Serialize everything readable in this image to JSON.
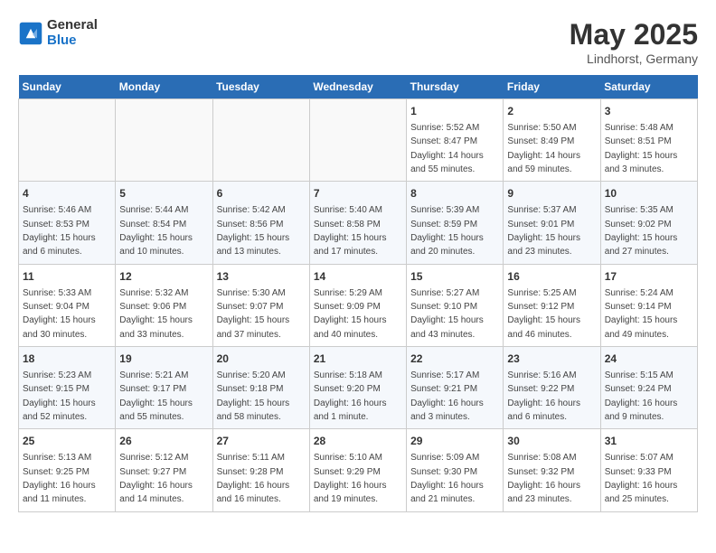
{
  "header": {
    "logo_general": "General",
    "logo_blue": "Blue",
    "title": "May 2025",
    "subtitle": "Lindhorst, Germany"
  },
  "days_of_week": [
    "Sunday",
    "Monday",
    "Tuesday",
    "Wednesday",
    "Thursday",
    "Friday",
    "Saturday"
  ],
  "weeks": [
    [
      {
        "day": "",
        "info": ""
      },
      {
        "day": "",
        "info": ""
      },
      {
        "day": "",
        "info": ""
      },
      {
        "day": "",
        "info": ""
      },
      {
        "day": "1",
        "info": "Sunrise: 5:52 AM\nSunset: 8:47 PM\nDaylight: 14 hours\nand 55 minutes."
      },
      {
        "day": "2",
        "info": "Sunrise: 5:50 AM\nSunset: 8:49 PM\nDaylight: 14 hours\nand 59 minutes."
      },
      {
        "day": "3",
        "info": "Sunrise: 5:48 AM\nSunset: 8:51 PM\nDaylight: 15 hours\nand 3 minutes."
      }
    ],
    [
      {
        "day": "4",
        "info": "Sunrise: 5:46 AM\nSunset: 8:53 PM\nDaylight: 15 hours\nand 6 minutes."
      },
      {
        "day": "5",
        "info": "Sunrise: 5:44 AM\nSunset: 8:54 PM\nDaylight: 15 hours\nand 10 minutes."
      },
      {
        "day": "6",
        "info": "Sunrise: 5:42 AM\nSunset: 8:56 PM\nDaylight: 15 hours\nand 13 minutes."
      },
      {
        "day": "7",
        "info": "Sunrise: 5:40 AM\nSunset: 8:58 PM\nDaylight: 15 hours\nand 17 minutes."
      },
      {
        "day": "8",
        "info": "Sunrise: 5:39 AM\nSunset: 8:59 PM\nDaylight: 15 hours\nand 20 minutes."
      },
      {
        "day": "9",
        "info": "Sunrise: 5:37 AM\nSunset: 9:01 PM\nDaylight: 15 hours\nand 23 minutes."
      },
      {
        "day": "10",
        "info": "Sunrise: 5:35 AM\nSunset: 9:02 PM\nDaylight: 15 hours\nand 27 minutes."
      }
    ],
    [
      {
        "day": "11",
        "info": "Sunrise: 5:33 AM\nSunset: 9:04 PM\nDaylight: 15 hours\nand 30 minutes."
      },
      {
        "day": "12",
        "info": "Sunrise: 5:32 AM\nSunset: 9:06 PM\nDaylight: 15 hours\nand 33 minutes."
      },
      {
        "day": "13",
        "info": "Sunrise: 5:30 AM\nSunset: 9:07 PM\nDaylight: 15 hours\nand 37 minutes."
      },
      {
        "day": "14",
        "info": "Sunrise: 5:29 AM\nSunset: 9:09 PM\nDaylight: 15 hours\nand 40 minutes."
      },
      {
        "day": "15",
        "info": "Sunrise: 5:27 AM\nSunset: 9:10 PM\nDaylight: 15 hours\nand 43 minutes."
      },
      {
        "day": "16",
        "info": "Sunrise: 5:25 AM\nSunset: 9:12 PM\nDaylight: 15 hours\nand 46 minutes."
      },
      {
        "day": "17",
        "info": "Sunrise: 5:24 AM\nSunset: 9:14 PM\nDaylight: 15 hours\nand 49 minutes."
      }
    ],
    [
      {
        "day": "18",
        "info": "Sunrise: 5:23 AM\nSunset: 9:15 PM\nDaylight: 15 hours\nand 52 minutes."
      },
      {
        "day": "19",
        "info": "Sunrise: 5:21 AM\nSunset: 9:17 PM\nDaylight: 15 hours\nand 55 minutes."
      },
      {
        "day": "20",
        "info": "Sunrise: 5:20 AM\nSunset: 9:18 PM\nDaylight: 15 hours\nand 58 minutes."
      },
      {
        "day": "21",
        "info": "Sunrise: 5:18 AM\nSunset: 9:20 PM\nDaylight: 16 hours\nand 1 minute."
      },
      {
        "day": "22",
        "info": "Sunrise: 5:17 AM\nSunset: 9:21 PM\nDaylight: 16 hours\nand 3 minutes."
      },
      {
        "day": "23",
        "info": "Sunrise: 5:16 AM\nSunset: 9:22 PM\nDaylight: 16 hours\nand 6 minutes."
      },
      {
        "day": "24",
        "info": "Sunrise: 5:15 AM\nSunset: 9:24 PM\nDaylight: 16 hours\nand 9 minutes."
      }
    ],
    [
      {
        "day": "25",
        "info": "Sunrise: 5:13 AM\nSunset: 9:25 PM\nDaylight: 16 hours\nand 11 minutes."
      },
      {
        "day": "26",
        "info": "Sunrise: 5:12 AM\nSunset: 9:27 PM\nDaylight: 16 hours\nand 14 minutes."
      },
      {
        "day": "27",
        "info": "Sunrise: 5:11 AM\nSunset: 9:28 PM\nDaylight: 16 hours\nand 16 minutes."
      },
      {
        "day": "28",
        "info": "Sunrise: 5:10 AM\nSunset: 9:29 PM\nDaylight: 16 hours\nand 19 minutes."
      },
      {
        "day": "29",
        "info": "Sunrise: 5:09 AM\nSunset: 9:30 PM\nDaylight: 16 hours\nand 21 minutes."
      },
      {
        "day": "30",
        "info": "Sunrise: 5:08 AM\nSunset: 9:32 PM\nDaylight: 16 hours\nand 23 minutes."
      },
      {
        "day": "31",
        "info": "Sunrise: 5:07 AM\nSunset: 9:33 PM\nDaylight: 16 hours\nand 25 minutes."
      }
    ]
  ]
}
